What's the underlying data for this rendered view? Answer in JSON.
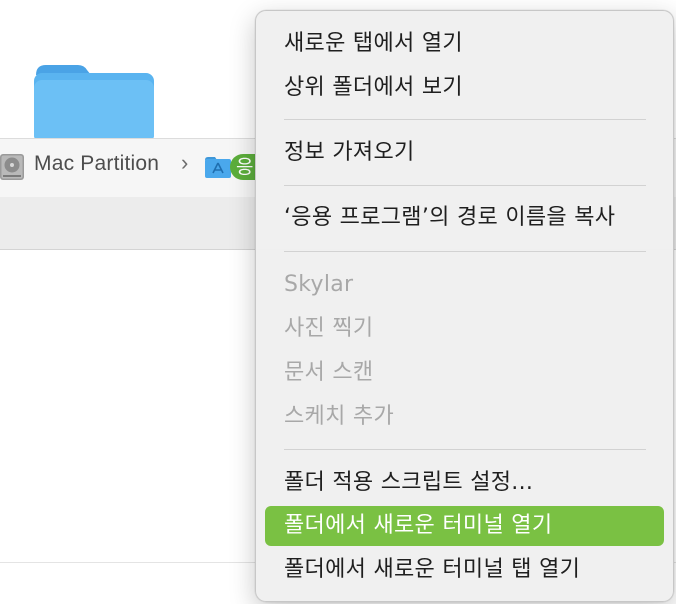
{
  "path_bar": {
    "disk_label": "Mac Partition",
    "chevron": "›",
    "tag_label": "응"
  },
  "context_menu": {
    "groups": [
      [
        {
          "label": "새로운 탭에서 열기",
          "enabled": true
        },
        {
          "label": "상위 폴더에서 보기",
          "enabled": true
        }
      ],
      [
        {
          "label": "정보 가져오기",
          "enabled": true
        }
      ],
      [
        {
          "label": "‘응용 프로그램’의 경로 이름을 복사",
          "enabled": true
        }
      ],
      [
        {
          "label": "Skylar",
          "enabled": false
        },
        {
          "label": "사진 찍기",
          "enabled": false
        },
        {
          "label": "문서 스캔",
          "enabled": false
        },
        {
          "label": "스케치 추가",
          "enabled": false
        }
      ],
      [
        {
          "label": "폴더 적용 스크립트 설정...",
          "enabled": true
        },
        {
          "label": "폴더에서 새로운 터미널 열기",
          "enabled": true,
          "highlighted": true
        },
        {
          "label": "폴더에서 새로운 터미널 탭 열기",
          "enabled": true
        }
      ]
    ]
  },
  "colors": {
    "highlight": "#7ac143",
    "folder_blue": "#5ab4f0",
    "tag_green": "#5cae3b",
    "disabled_text": "#a8a8a8"
  },
  "icons": [
    "folder-icon",
    "disk-icon",
    "applications-folder-icon"
  ]
}
